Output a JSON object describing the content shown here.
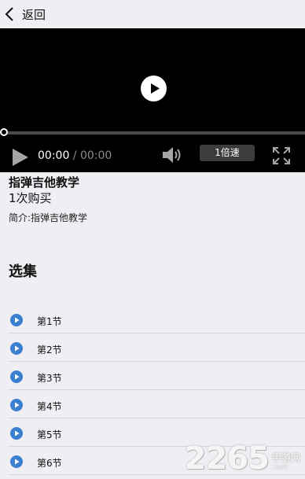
{
  "header": {
    "back_label": "返回"
  },
  "player": {
    "current_time": "00:00",
    "separator": " / ",
    "duration": "00:00",
    "speed_label": "1倍速",
    "progress": 0
  },
  "course": {
    "title": "指弹吉他教学",
    "purchases": "1次购买",
    "intro": "简介:指弹吉他教学"
  },
  "episodes_section": {
    "title": "选集"
  },
  "episodes": [
    {
      "label": "第1节"
    },
    {
      "label": "第2节"
    },
    {
      "label": "第3节"
    },
    {
      "label": "第4节"
    },
    {
      "label": "第5节"
    },
    {
      "label": "第6节"
    }
  ],
  "watermark": {
    "main": "2265",
    "sub": "手游网",
    "url": ".com"
  },
  "colors": {
    "accent": "#3a7fd0",
    "background": "#efeef3",
    "player_bg": "#000000"
  },
  "icons": {
    "back": "chevron-left-icon",
    "big_play": "play-circle-icon",
    "play": "play-icon",
    "volume": "volume-icon",
    "fullscreen": "fullscreen-icon",
    "episode": "play-circle-blue-icon"
  }
}
